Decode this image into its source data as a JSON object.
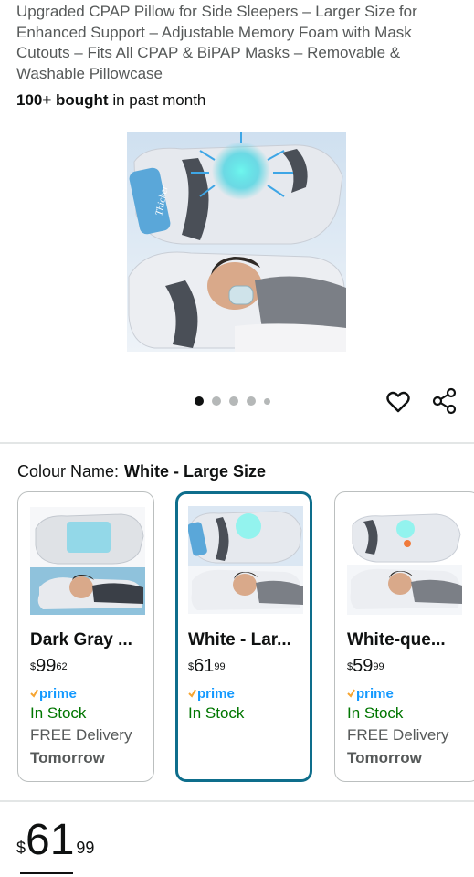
{
  "product": {
    "title": "Upgraded CPAP Pillow for Side Sleepers – Larger Size for Enhanced Support – Adjustable Memory Foam with Mask Cutouts – Fits All CPAP & BiPAP Masks – Removable & Washable Pillowcase",
    "bought_count": "100+ bought",
    "bought_suffix": " in past month",
    "image_label": "Thicker",
    "carousel": {
      "total": 5,
      "active_index": 0
    }
  },
  "actions": {
    "wishlist_icon": "heart-icon",
    "share_icon": "share-icon"
  },
  "colour": {
    "label": "Colour Name:",
    "selected": "White - Large Size"
  },
  "variants": [
    {
      "name": "Dark Gray ...",
      "currency": "$",
      "price_whole": "99",
      "price_cents": "62",
      "prime": "prime",
      "stock": "In Stock",
      "delivery": "FREE Delivery",
      "delivery_date": "Tomorrow",
      "selected": false
    },
    {
      "name": "White - Lar...",
      "currency": "$",
      "price_whole": "61",
      "price_cents": "99",
      "prime": "prime",
      "stock": "In Stock",
      "selected": true
    },
    {
      "name": "White-que...",
      "currency": "$",
      "price_whole": "59",
      "price_cents": "99",
      "prime": "prime",
      "stock": "In Stock",
      "delivery": "FREE Delivery",
      "delivery_date": "Tomorrow",
      "selected": false
    }
  ],
  "price": {
    "currency": "$",
    "whole": "61",
    "cents": "99"
  },
  "colors": {
    "prime_blue": "#1399ff",
    "prime_check": "#f7a531",
    "stock_green": "#007600",
    "selected_border": "#0e6e8c"
  }
}
